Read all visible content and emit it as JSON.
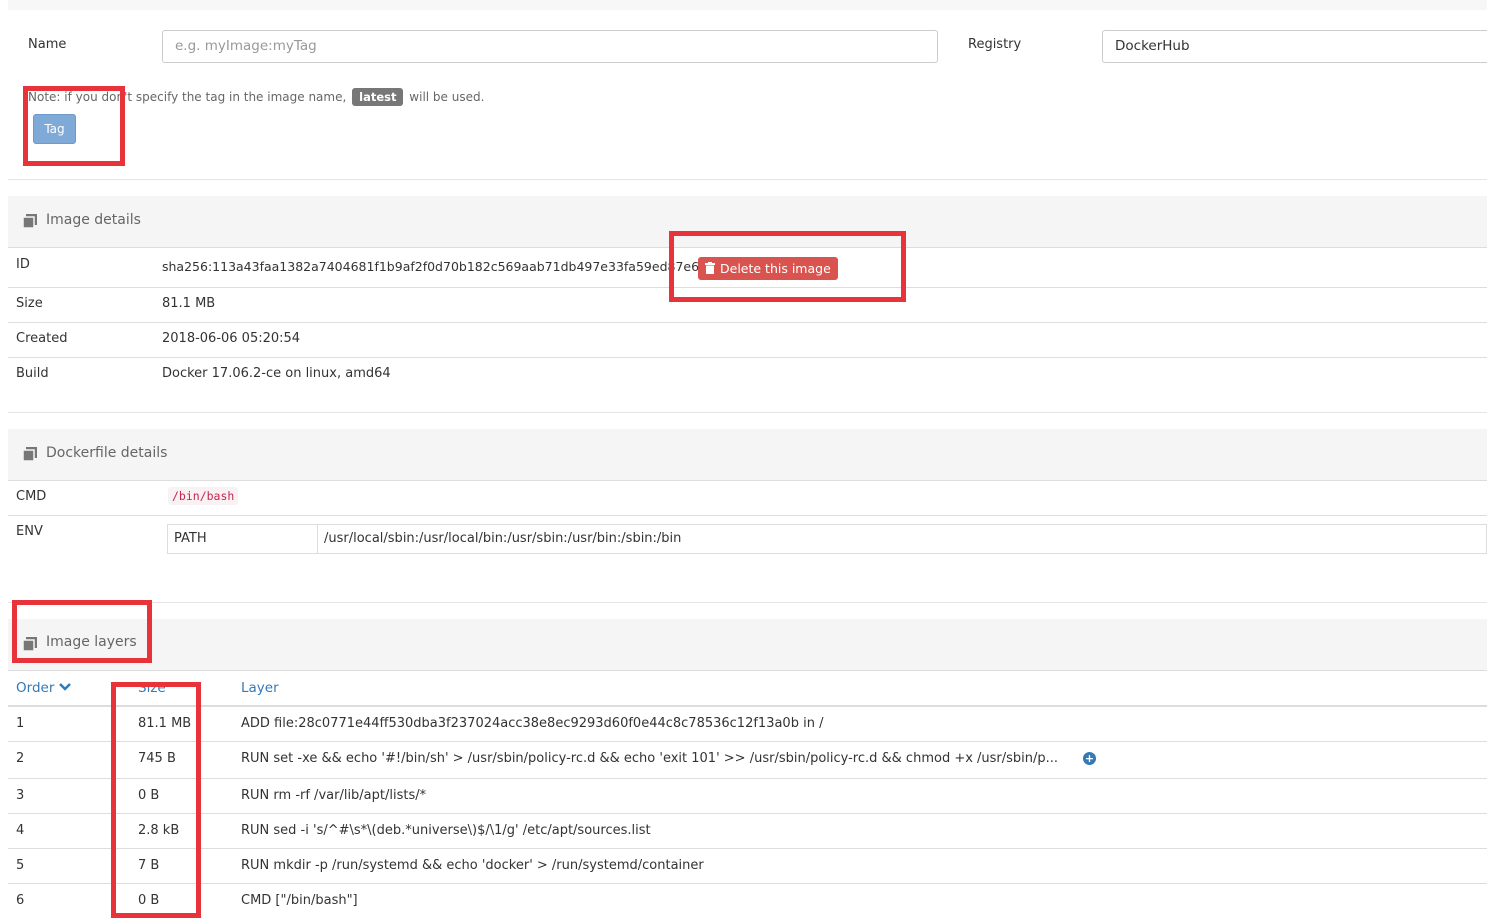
{
  "tag_form": {
    "name_label": "Name",
    "name_placeholder": "e.g. myImage:myTag",
    "registry_label": "Registry",
    "registry_value": "DockerHub",
    "note_prefix": "Note: if you don't specify the tag in the image name,",
    "note_badge": "latest",
    "note_suffix": "will be used.",
    "tag_button": "Tag"
  },
  "image_details": {
    "title": "Image details",
    "rows": {
      "id_label": "ID",
      "id_value": "sha256:113a43faa1382a7404681f1b9af2f0d70b182c569aab71db497e33fa59ed87e6",
      "size_label": "Size",
      "size_value": "81.1 MB",
      "created_label": "Created",
      "created_value": "2018-06-06 05:20:54",
      "build_label": "Build",
      "build_value": "Docker 17.06.2-ce on linux, amd64"
    },
    "delete_button": "Delete this image"
  },
  "dockerfile_details": {
    "title": "Dockerfile details",
    "cmd_label": "CMD",
    "cmd_value": "/bin/bash",
    "env_label": "ENV",
    "env_key": "PATH",
    "env_value": "/usr/local/sbin:/usr/local/bin:/usr/sbin:/usr/bin:/sbin:/bin"
  },
  "image_layers": {
    "title": "Image layers",
    "headers": {
      "order": "Order",
      "size": "Size",
      "layer": "Layer"
    },
    "rows": [
      {
        "order": "1",
        "size": "81.1 MB",
        "layer": "ADD file:28c0771e44ff530dba3f237024acc38e8ec9293d60f0e44c8c78536c12f13a0b in /"
      },
      {
        "order": "2",
        "size": "745 B",
        "layer": "RUN set -xe && echo '#!/bin/sh' > /usr/sbin/policy-rc.d && echo 'exit 101' >> /usr/sbin/policy-rc.d && chmod +x /usr/sbin/p..."
      },
      {
        "order": "3",
        "size": "0 B",
        "layer": "RUN rm -rf /var/lib/apt/lists/*"
      },
      {
        "order": "4",
        "size": "2.8 kB",
        "layer": "RUN sed -i 's/^#\\s*\\(deb.*universe\\)$/\\1/g' /etc/apt/sources.list"
      },
      {
        "order": "5",
        "size": "7 B",
        "layer": "RUN mkdir -p /run/systemd && echo 'docker' > /run/systemd/container"
      },
      {
        "order": "6",
        "size": "0 B",
        "layer": "CMD [\"/bin/bash\"]"
      }
    ]
  },
  "colors": {
    "highlight": "#e8333a",
    "link": "#337ab7",
    "danger": "#d9534f",
    "primary_disabled": "#7fa9d6"
  }
}
